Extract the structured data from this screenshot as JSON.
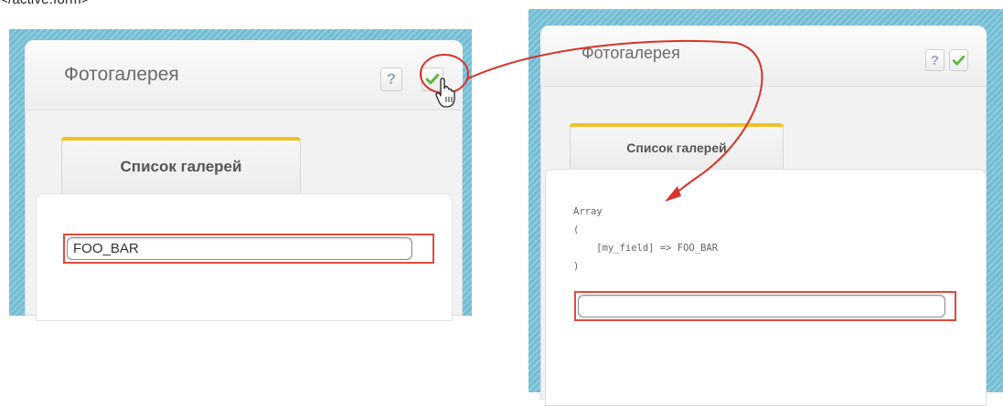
{
  "page": {
    "top_fragment": "</active.form>"
  },
  "left_panel": {
    "title": "Фотогалерея",
    "help_label": "?",
    "confirm_icon": "checkmark-icon",
    "tab_label": "Список галерей",
    "input_value": "FOO_BAR"
  },
  "right_panel": {
    "title": "Фотогалерея",
    "help_label": "?",
    "confirm_icon": "checkmark-icon",
    "tab_label": "Список галерей",
    "output_lines": [
      "Array",
      "(",
      "    [my_field] => FOO_BAR",
      ")"
    ],
    "input_value": ""
  },
  "annotations": {
    "color": "#e14b3b",
    "cursor_icon": "hand-pointer-icon"
  },
  "colors": {
    "frame": "#72bdd4",
    "tab_accent": "#f2c122",
    "check_green": "#5db83a"
  }
}
